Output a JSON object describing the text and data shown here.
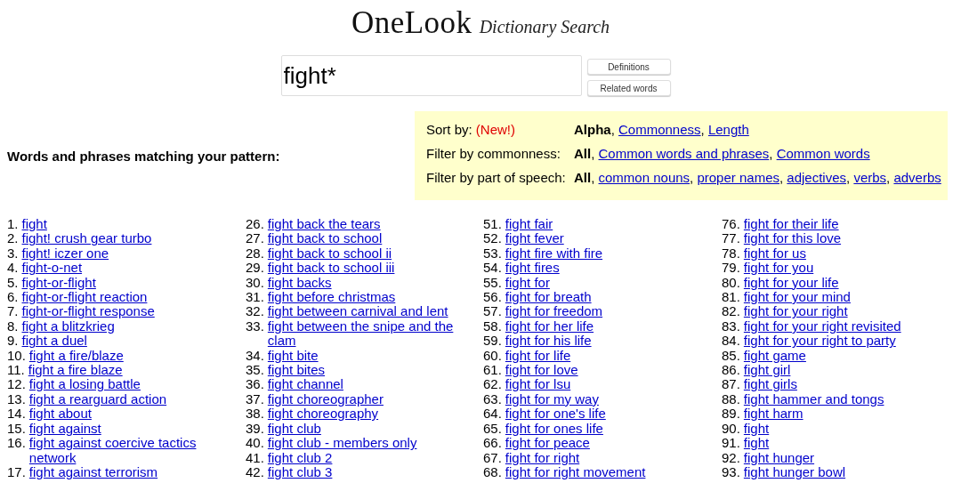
{
  "logo": {
    "name": "OneLook",
    "tagline": "Dictionary Search"
  },
  "search": {
    "value": "fight*",
    "buttons": [
      "Definitions",
      "Related words"
    ]
  },
  "heading": "Words and phrases matching your pattern:",
  "filters": [
    {
      "label": "Sort by:",
      "badge": "(New!)",
      "separator": ",",
      "options": [
        {
          "label": "Alpha",
          "selected": true
        },
        {
          "label": "Commonness",
          "selected": false
        },
        {
          "label": "Length",
          "selected": false
        }
      ]
    },
    {
      "label": "Filter by commonness:",
      "separator": ",",
      "options": [
        {
          "label": "All",
          "selected": true
        },
        {
          "label": "Common words and phrases",
          "selected": false
        },
        {
          "label": "Common words",
          "selected": false
        }
      ]
    },
    {
      "label": "Filter by part of speech:",
      "separator": ",",
      "options": [
        {
          "label": "All",
          "selected": true
        },
        {
          "label": "common nouns",
          "selected": false
        },
        {
          "label": "proper names",
          "selected": false
        },
        {
          "label": "adjectives",
          "selected": false
        },
        {
          "label": "verbs",
          "selected": false
        },
        {
          "label": "adverbs",
          "selected": false
        }
      ]
    }
  ],
  "results": [
    [
      {
        "number": "1.",
        "word": "fight"
      },
      {
        "number": "2.",
        "word": "fight! crush gear turbo"
      },
      {
        "number": "3.",
        "word": "fight! iczer one"
      },
      {
        "number": "4.",
        "word": "fight-o-net"
      },
      {
        "number": "5.",
        "word": "fight-or-flight"
      },
      {
        "number": "6.",
        "word": "fight-or-flight reaction"
      },
      {
        "number": "7.",
        "word": "fight-or-flight response"
      },
      {
        "number": "8.",
        "word": "fight a blitzkrieg"
      },
      {
        "number": "9.",
        "word": "fight a duel"
      },
      {
        "number": "10.",
        "word": "fight a fire/blaze"
      },
      {
        "number": "11.",
        "word": "fight a fire blaze"
      },
      {
        "number": "12.",
        "word": "fight a losing battle"
      },
      {
        "number": "13.",
        "word": "fight a rearguard action"
      },
      {
        "number": "14.",
        "word": "fight about"
      },
      {
        "number": "15.",
        "word": "fight against"
      },
      {
        "number": "16.",
        "word": "fight against coercive tactics network"
      },
      {
        "number": "17.",
        "word": "fight against terrorism"
      }
    ],
    [
      {
        "number": "26.",
        "word": "fight back the tears"
      },
      {
        "number": "27.",
        "word": "fight back to school"
      },
      {
        "number": "28.",
        "word": "fight back to school ii"
      },
      {
        "number": "29.",
        "word": "fight back to school iii"
      },
      {
        "number": "30.",
        "word": "fight backs"
      },
      {
        "number": "31.",
        "word": "fight before christmas"
      },
      {
        "number": "32.",
        "word": "fight between carnival and lent"
      },
      {
        "number": "33.",
        "word": "fight between the snipe and the clam"
      },
      {
        "number": "34.",
        "word": "fight bite"
      },
      {
        "number": "35.",
        "word": "fight bites"
      },
      {
        "number": "36.",
        "word": "fight channel"
      },
      {
        "number": "37.",
        "word": "fight choreographer"
      },
      {
        "number": "38.",
        "word": "fight choreography"
      },
      {
        "number": "39.",
        "word": "fight club"
      },
      {
        "number": "40.",
        "word": "fight club - members only"
      },
      {
        "number": "41.",
        "word": "fight club 2"
      },
      {
        "number": "42.",
        "word": "fight club 3"
      }
    ],
    [
      {
        "number": "51.",
        "word": "fight fair"
      },
      {
        "number": "52.",
        "word": "fight fever"
      },
      {
        "number": "53.",
        "word": "fight fire with fire"
      },
      {
        "number": "54.",
        "word": "fight fires"
      },
      {
        "number": "55.",
        "word": "fight for"
      },
      {
        "number": "56.",
        "word": "fight for breath"
      },
      {
        "number": "57.",
        "word": "fight for freedom"
      },
      {
        "number": "58.",
        "word": "fight for her life"
      },
      {
        "number": "59.",
        "word": "fight for his life"
      },
      {
        "number": "60.",
        "word": "fight for life"
      },
      {
        "number": "61.",
        "word": "fight for love"
      },
      {
        "number": "62.",
        "word": "fight for lsu"
      },
      {
        "number": "63.",
        "word": "fight for my way"
      },
      {
        "number": "64.",
        "word": "fight for one's life"
      },
      {
        "number": "65.",
        "word": "fight for ones life"
      },
      {
        "number": "66.",
        "word": "fight for peace"
      },
      {
        "number": "67.",
        "word": "fight for right"
      },
      {
        "number": "68.",
        "word": "fight for right movement"
      }
    ],
    [
      {
        "number": "76.",
        "word": "fight for their life"
      },
      {
        "number": "77.",
        "word": "fight for this love"
      },
      {
        "number": "78.",
        "word": "fight for us"
      },
      {
        "number": "79.",
        "word": "fight for you"
      },
      {
        "number": "80.",
        "word": "fight for your life"
      },
      {
        "number": "81.",
        "word": "fight for your mind"
      },
      {
        "number": "82.",
        "word": "fight for your right"
      },
      {
        "number": "83.",
        "word": "fight for your right revisited"
      },
      {
        "number": "84.",
        "word": "fight for your right to party"
      },
      {
        "number": "85.",
        "word": "fight game"
      },
      {
        "number": "86.",
        "word": "fight girl"
      },
      {
        "number": "87.",
        "word": "fight girls"
      },
      {
        "number": "88.",
        "word": "fight hammer and tongs"
      },
      {
        "number": "89.",
        "word": "fight harm"
      },
      {
        "number": "90.",
        "word": "fight"
      },
      {
        "number": "91.",
        "word": "fight"
      },
      {
        "number": "92.",
        "word": "fight hunger"
      },
      {
        "number": "93.",
        "word": "fight hunger bowl"
      }
    ]
  ]
}
